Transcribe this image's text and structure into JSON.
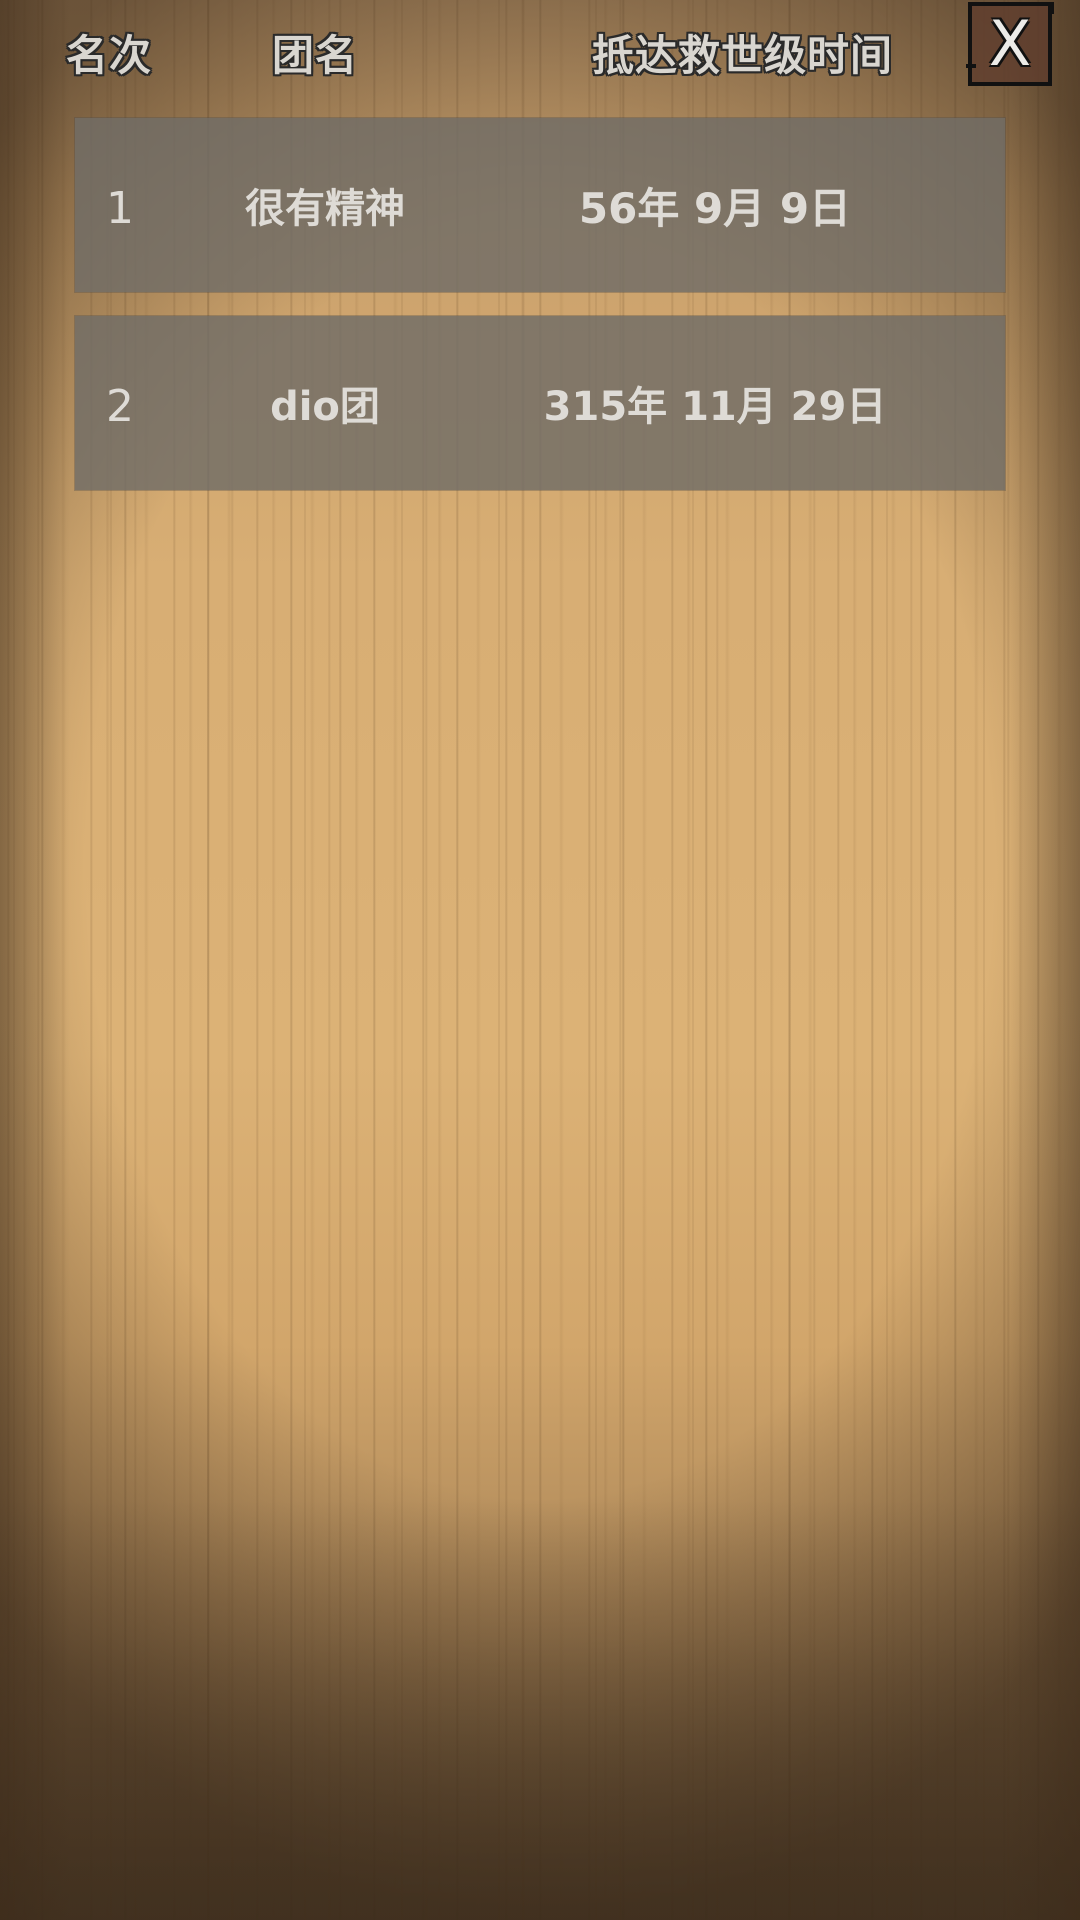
{
  "header": {
    "rank_label": "名次",
    "team_label": "团名",
    "time_label": "抵达救世级时间",
    "close_label": "X"
  },
  "leaderboard": [
    {
      "rank": "1",
      "team": "很有精神",
      "time": "56年 9月 9日"
    },
    {
      "rank": "2",
      "team": "dio团",
      "time": "315年 11月 29日"
    }
  ]
}
